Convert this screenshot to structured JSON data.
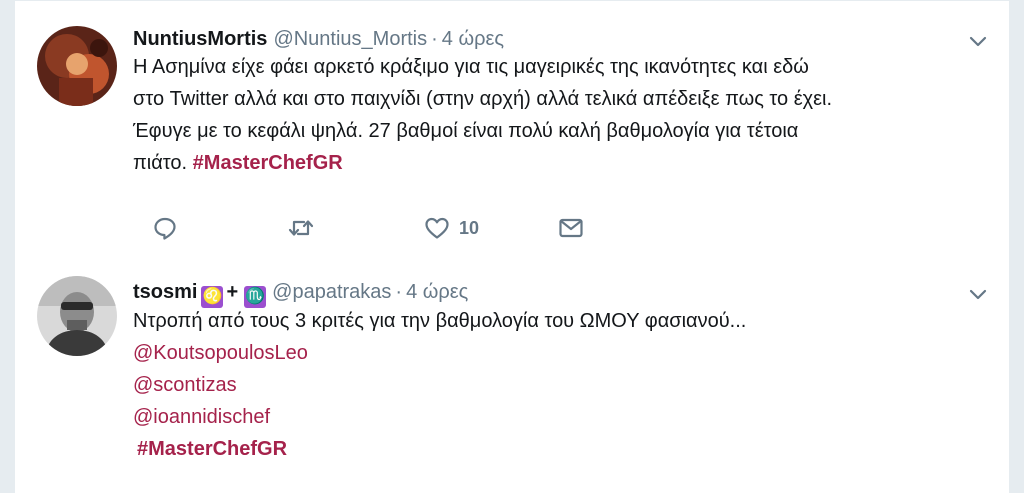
{
  "tweets": [
    {
      "fullname": "NuntiusMortis",
      "handle": "@Nuntius_Mortis",
      "separator": "·",
      "time": "4 ώρες",
      "text_lines": [
        "Η Ασημίνα είχε φάει αρκετό κράξιμο για τις μαγειρικές της ικανότητες και εδώ",
        "στο Twitter αλλά και στο παιχνίδι (στην αρχή) αλλά τελικά απέδειξε πως το έχει.",
        "Έφυγε με το κεφάλι ψηλά. 27 βαθμοί είναι πολύ καλή βαθμολογία για τέτοια",
        "πιάτο."
      ],
      "hashtag": "#MasterChefGR",
      "actions": {
        "reply_icon": "reply-icon",
        "retweet_icon": "retweet-icon",
        "like_icon": "heart-icon",
        "like_count": "10",
        "dm_icon": "envelope-icon"
      }
    },
    {
      "fullname": "tsosmi",
      "emoji_1": "♌",
      "plus": "+",
      "emoji_2": "♏",
      "handle": "@papatrakas",
      "separator": "·",
      "time": "4 ώρες",
      "text": "Ντροπή από τους 3 κριτές για την βαθμολογία του ΩΜΟΥ φασιανού...",
      "mentions": [
        "@KoutsopoulosLeo",
        "@scontizas",
        "@ioannidischef"
      ],
      "hashtag": "#MasterChefGR"
    }
  ],
  "colors": {
    "accent": "#a5224b",
    "secondary_text": "#657786",
    "border": "#e6ecf0"
  }
}
